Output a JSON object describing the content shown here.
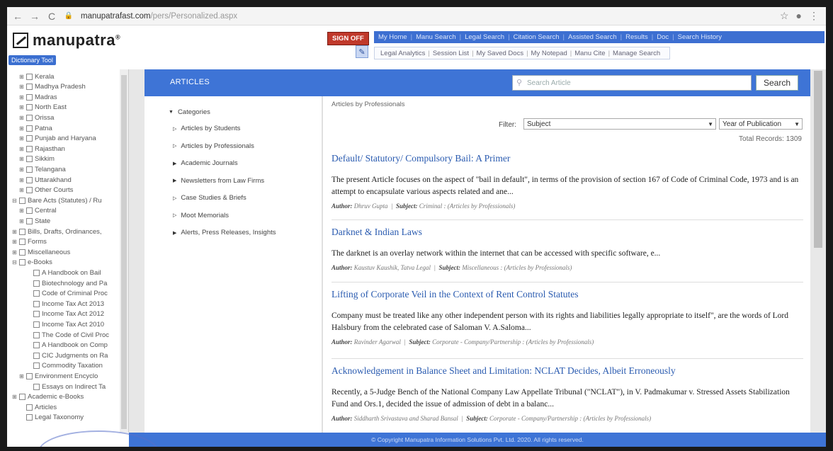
{
  "browser": {
    "url_domain": "manupatrafast.com",
    "url_path": "/pers/Personalized.aspx"
  },
  "header": {
    "logo_text": "manupatra",
    "logo_reg": "®",
    "dictionary_label": "Dictionary Tool",
    "signout_label": "SIGN OFF",
    "top_nav": [
      "My Home",
      "Manu Search",
      "Legal Search",
      "Citation Search",
      "Assisted Search",
      "Results",
      "Doc",
      "Search History"
    ],
    "sub_nav": [
      "Legal Analytics",
      "Session List",
      "My Saved Docs",
      "My Notepad",
      "Manu Cite",
      "Manage Search"
    ]
  },
  "tree": [
    {
      "label": "Kerala",
      "exp": "⊞",
      "indent": 1
    },
    {
      "label": "Madhya Pradesh",
      "exp": "⊞",
      "indent": 1
    },
    {
      "label": "Madras",
      "exp": "⊞",
      "indent": 1
    },
    {
      "label": "North East",
      "exp": "⊞",
      "indent": 1
    },
    {
      "label": "Orissa",
      "exp": "⊞",
      "indent": 1
    },
    {
      "label": "Patna",
      "exp": "⊞",
      "indent": 1
    },
    {
      "label": "Punjab and Haryana",
      "exp": "⊞",
      "indent": 1
    },
    {
      "label": "Rajasthan",
      "exp": "⊞",
      "indent": 1
    },
    {
      "label": "Sikkim",
      "exp": "⊞",
      "indent": 1
    },
    {
      "label": "Telangana",
      "exp": "⊞",
      "indent": 1
    },
    {
      "label": "Uttarakhand",
      "exp": "⊞",
      "indent": 1
    },
    {
      "label": "Other Courts",
      "exp": "⊞",
      "indent": 1
    },
    {
      "label": "Bare Acts (Statutes) / Ru",
      "exp": "⊟",
      "indent": 0
    },
    {
      "label": "Central",
      "exp": "⊞",
      "indent": 1
    },
    {
      "label": "State",
      "exp": "⊞",
      "indent": 1
    },
    {
      "label": "Bills, Drafts, Ordinances,",
      "exp": "⊞",
      "indent": 0
    },
    {
      "label": "Forms",
      "exp": "⊞",
      "indent": 0
    },
    {
      "label": "Miscellaneous",
      "exp": "⊞",
      "indent": 0
    },
    {
      "label": "e-Books",
      "exp": "⊟",
      "indent": 0
    },
    {
      "label": "A Handbook on Bail",
      "exp": "",
      "indent": 2
    },
    {
      "label": "Biotechnology and Pa",
      "exp": "",
      "indent": 2
    },
    {
      "label": "Code of Criminal Proc",
      "exp": "",
      "indent": 2
    },
    {
      "label": "Income Tax Act 2013",
      "exp": "",
      "indent": 2
    },
    {
      "label": "Income Tax Act 2012",
      "exp": "",
      "indent": 2
    },
    {
      "label": "Income Tax Act 2010",
      "exp": "",
      "indent": 2
    },
    {
      "label": "The Code of Civil Proc",
      "exp": "",
      "indent": 2
    },
    {
      "label": "A Handbook on Comp",
      "exp": "",
      "indent": 2
    },
    {
      "label": "CIC Judgments on Ra",
      "exp": "",
      "indent": 2
    },
    {
      "label": "Commodity Taxation",
      "exp": "",
      "indent": 2
    },
    {
      "label": "Environment Encyclo",
      "exp": "⊞",
      "indent": 1
    },
    {
      "label": "Essays on Indirect Ta",
      "exp": "",
      "indent": 2
    },
    {
      "label": "Academic e-Books",
      "exp": "⊞",
      "indent": 0
    },
    {
      "label": "Articles",
      "exp": "",
      "indent": 1
    },
    {
      "label": "Legal Taxonomy",
      "exp": "",
      "indent": 1
    }
  ],
  "main": {
    "title": "ARTICLES",
    "search_placeholder": "Search Article",
    "search_button": "Search",
    "breadcrumb": "Articles by Professionals",
    "filter_label": "Filter:",
    "filter_value": "Subject",
    "year_value": "Year of Publication",
    "total_records": "Total Records: 1309"
  },
  "categories": {
    "root": "Categories",
    "items": [
      {
        "label": "Articles by Students",
        "arrow": "▷"
      },
      {
        "label": "Articles by Professionals",
        "arrow": "▷"
      },
      {
        "label": "Academic Journals",
        "arrow": "▶"
      },
      {
        "label": "Newsletters from Law Firms",
        "arrow": "▶"
      },
      {
        "label": "Case Studies & Briefs",
        "arrow": "▷"
      },
      {
        "label": "Moot Memorials",
        "arrow": "▷"
      },
      {
        "label": "Alerts, Press Releases, Insights",
        "arrow": "▶"
      }
    ]
  },
  "articles": [
    {
      "title": "Default/ Statutory/ Compulsory Bail: A Primer",
      "body": "The present Article focuses on the aspect of \"bail in default\", in terms of the provision of section 167 of Code of Criminal Code, 1973 and is an attempt to encapsulate various aspects related and ane...",
      "author_label": "Author:",
      "author": "Dhruv Gupta",
      "subject_label": "Subject:",
      "subject": "Criminal : (Articles by Professionals)"
    },
    {
      "title": "Darknet & Indian Laws",
      "body": "The darknet is an overlay network within the internet that can be accessed with specific software, e...",
      "author_label": "Author:",
      "author": "Kaustuv Kaushik, Tatva Legal",
      "subject_label": "Subject:",
      "subject": "Miscellaneous : (Articles by Professionals)"
    },
    {
      "title": "Lifting of Corporate Veil in the Context of Rent Control Statutes",
      "body": "Company must be treated like any other independent person with its rights and liabilities legally appropriate to itself\", are the words of Lord Halsbury from the celebrated case of Saloman V. A.Saloma...",
      "author_label": "Author:",
      "author": "Ravinder Agarwal",
      "subject_label": "Subject:",
      "subject": "Corporate - Company/Partnership : (Articles by Professionals)"
    },
    {
      "title": "Acknowledgement in Balance Sheet and Limitation: NCLAT Decides, Albeit Erroneously",
      "body": "Recently, a 5-Judge Bench of the National Company Law Appellate Tribunal (\"NCLAT\"), in V. Padmakumar v. Stressed Assets Stabilization Fund and Ors.1, decided the issue of admission of debt in a balanc...",
      "author_label": "Author:",
      "author": "Siddharth Srivastava and Sharad Bansal",
      "subject_label": "Subject:",
      "subject": "Corporate - Company/Partnership : (Articles by Professionals)"
    }
  ],
  "footer": {
    "text": "© Copyright Manupatra Information Solutions Pvt. Ltd. 2020. All rights reserved."
  }
}
